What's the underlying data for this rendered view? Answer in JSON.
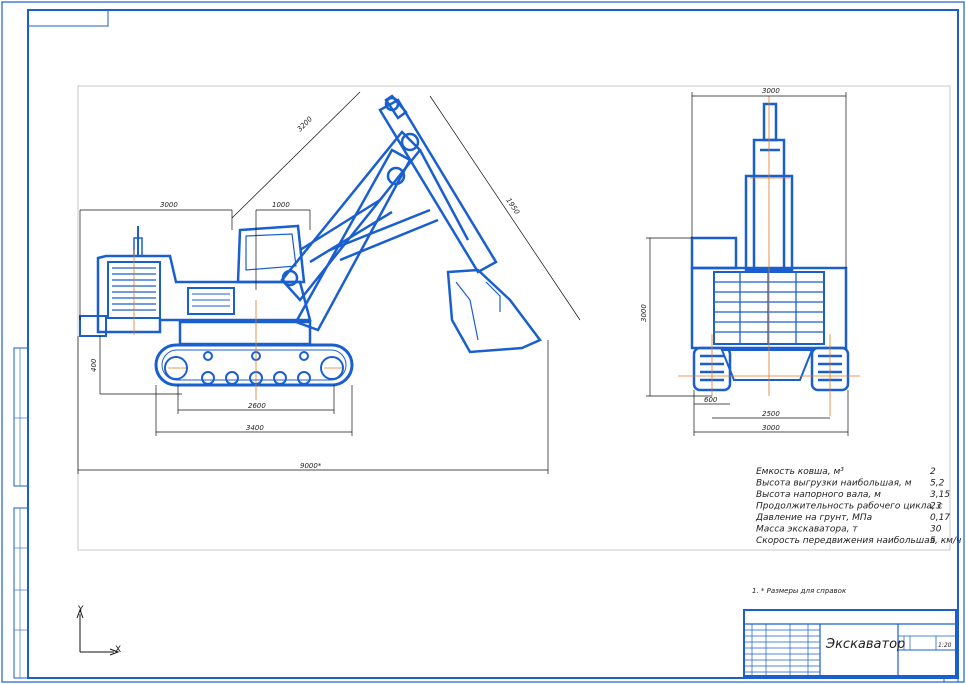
{
  "drawing": {
    "title": "Экскаватор",
    "scale": "1:20",
    "note": "1. * Размеры для справок",
    "axes": {
      "y": "Y",
      "x": "X"
    }
  },
  "dimensions": {
    "side": {
      "d3000": "3000",
      "d1000": "1000",
      "d3200": "3200",
      "d1950": "1950",
      "d400": "400",
      "d2600": "2600",
      "d3400": "3400",
      "d9000": "9000*"
    },
    "front": {
      "d3000_top": "3000",
      "d3000_left": "3000",
      "d600": "600",
      "d2500": "2500",
      "d3000_bottom": "3000"
    }
  },
  "specs": [
    {
      "label": "Емкость ковша, м³",
      "value": "2"
    },
    {
      "label": "Высота выгрузки наибольшая, м",
      "value": "5,2"
    },
    {
      "label": "Высота напорного вала, м",
      "value": "3,15"
    },
    {
      "label": "Продолжительность рабочего цикла, с",
      "value": "23"
    },
    {
      "label": "Давление на грунт, МПа",
      "value": "0,17"
    },
    {
      "label": "Масса экскаватора, т",
      "value": "30"
    },
    {
      "label": "Скорость передвижения наибольшая, км/ч",
      "value": "5"
    }
  ],
  "colors": {
    "accent": "#1a5fd0",
    "frame": "#1a5fd0",
    "line": "#111111",
    "centerline": "#e07a20"
  }
}
